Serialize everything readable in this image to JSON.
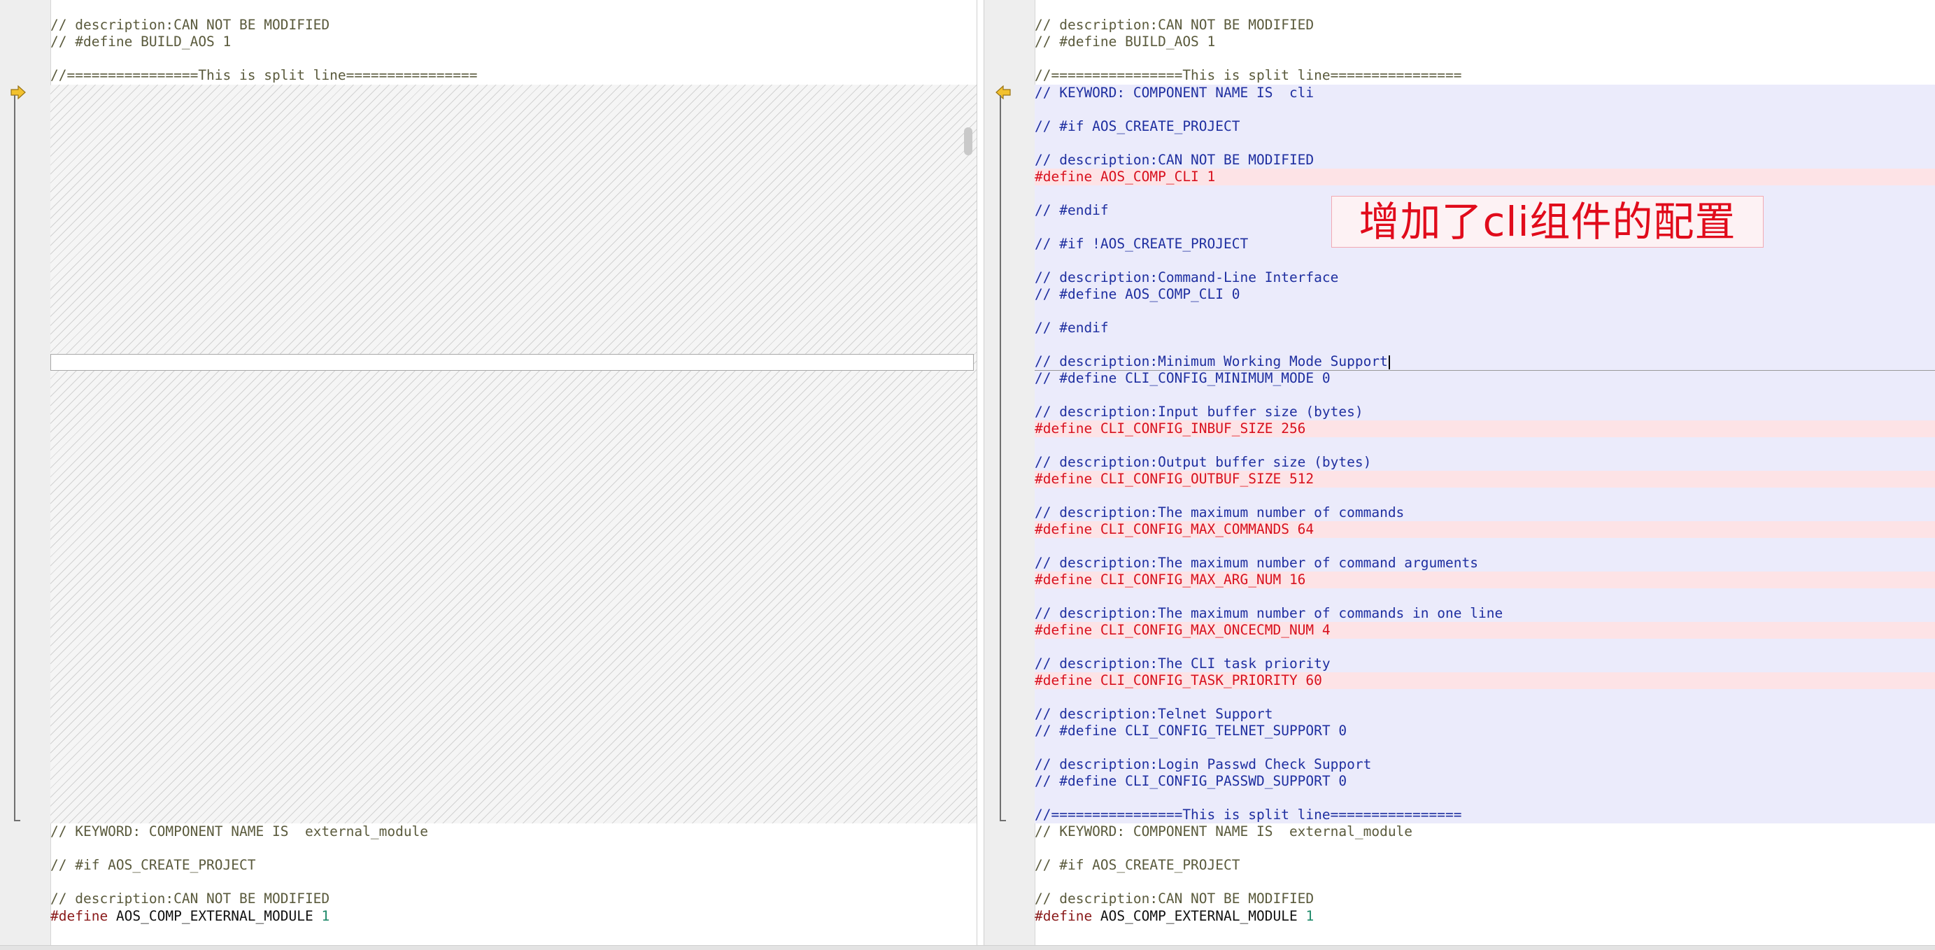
{
  "left": {
    "header_lines": [
      "// description:CAN NOT BE MODIFIED",
      "// #define BUILD_AOS 1",
      "",
      "//================This is split line================"
    ],
    "footer_lines": [
      "// KEYWORD: COMPONENT NAME IS  external_module",
      "",
      "// #if AOS_CREATE_PROJECT",
      "",
      "// description:CAN NOT BE MODIFIED"
    ],
    "define_kw": "#define",
    "define_name": "AOS_COMP_EXTERNAL_MODULE",
    "define_value": "1"
  },
  "right": {
    "header_lines": [
      "// description:CAN NOT BE MODIFIED",
      "// #define BUILD_AOS 1",
      "",
      "//================This is split line================"
    ],
    "added_lines": [
      "// KEYWORD: COMPONENT NAME IS  cli",
      "",
      "// #if AOS_CREATE_PROJECT",
      "",
      "// description:CAN NOT BE MODIFIED",
      "#define AOS_COMP_CLI 1",
      "",
      "// #endif",
      "",
      "// #if !AOS_CREATE_PROJECT",
      "",
      "// description:Command-Line Interface",
      "// #define AOS_COMP_CLI 0",
      "",
      "// #endif",
      "",
      "// description:Minimum Working Mode Support",
      "// #define CLI_CONFIG_MINIMUM_MODE 0",
      "",
      "// description:Input buffer size (bytes)",
      "#define CLI_CONFIG_INBUF_SIZE 256",
      "",
      "// description:Output buffer size (bytes)",
      "#define CLI_CONFIG_OUTBUF_SIZE 512",
      "",
      "// description:The maximum number of commands",
      "#define CLI_CONFIG_MAX_COMMANDS 64",
      "",
      "// description:The maximum number of command arguments",
      "#define CLI_CONFIG_MAX_ARG_NUM 16",
      "",
      "// description:The maximum number of commands in one line",
      "#define CLI_CONFIG_MAX_ONCECMD_NUM 4",
      "",
      "// description:The CLI task priority",
      "#define CLI_CONFIG_TASK_PRIORITY 60",
      "",
      "// description:Telnet Support",
      "// #define CLI_CONFIG_TELNET_SUPPORT 0",
      "",
      "// description:Login Passwd Check Support",
      "// #define CLI_CONFIG_PASSWD_SUPPORT 0",
      "",
      "//================This is split line================"
    ],
    "footer_lines": [
      "// KEYWORD: COMPONENT NAME IS  external_module",
      "",
      "// #if AOS_CREATE_PROJECT",
      "",
      "// description:CAN NOT BE MODIFIED"
    ],
    "define_kw": "#define",
    "define_name": "AOS_COMP_EXTERNAL_MODULE",
    "define_value": "1"
  },
  "annotation": "增加了cli组件的配置",
  "icons": {
    "left_change_marker": "arrow-right-icon",
    "right_change_marker": "arrow-left-icon"
  },
  "colors": {
    "added_block_bg": "#ebebfb",
    "changed_line_bg": "#fde3e6",
    "changed_line_text": "#d8111e",
    "comment_text": "#1f2fa0",
    "annotation_text": "#e10b1b",
    "marker_yellow": "#f2c12e"
  }
}
